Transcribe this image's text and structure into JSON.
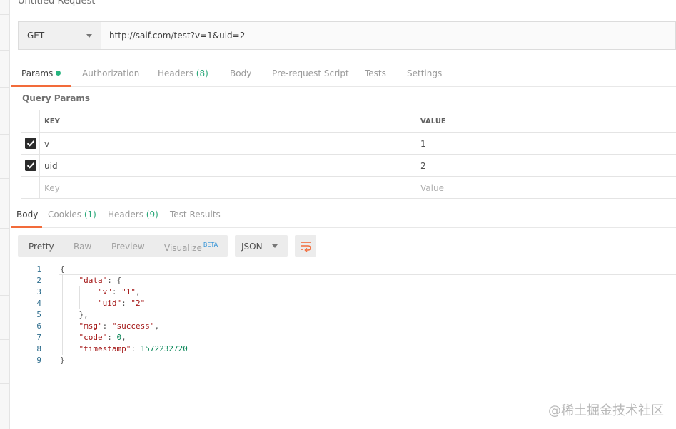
{
  "request": {
    "title": "Untitled Request",
    "method": "GET",
    "url": "http://saif.com/test?v=1&uid=2"
  },
  "request_tabs": [
    {
      "label": "Params",
      "active": true,
      "has_dot": true
    },
    {
      "label": "Authorization"
    },
    {
      "label": "Headers",
      "count": "(8)"
    },
    {
      "label": "Body"
    },
    {
      "label": "Pre-request Script"
    },
    {
      "label": "Tests"
    },
    {
      "label": "Settings"
    }
  ],
  "query_params": {
    "title": "Query Params",
    "header": {
      "key": "KEY",
      "value": "VALUE"
    },
    "rows": [
      {
        "key": "v",
        "value": "1",
        "checked": true
      },
      {
        "key": "uid",
        "value": "2",
        "checked": true
      }
    ],
    "placeholder": {
      "key": "Key",
      "value": "Value"
    }
  },
  "response_tabs": [
    {
      "label": "Body",
      "active": true
    },
    {
      "label": "Cookies",
      "count": "(1)"
    },
    {
      "label": "Headers",
      "count": "(9)"
    },
    {
      "label": "Test Results"
    }
  ],
  "view_modes": [
    "Pretty",
    "Raw",
    "Preview",
    "Visualize"
  ],
  "active_view": "Pretty",
  "beta_label": "BETA",
  "format": "JSON",
  "code_lines": [
    "1",
    "2",
    "3",
    "4",
    "5",
    "6",
    "7",
    "8",
    "9"
  ],
  "response_body": {
    "data_key": "\"data\"",
    "v_key": "\"v\"",
    "v_val": "\"1\"",
    "uid_key": "\"uid\"",
    "uid_val": "\"2\"",
    "msg_key": "\"msg\"",
    "msg_val": "\"success\"",
    "code_key": "\"code\"",
    "code_val": "0",
    "ts_key": "\"timestamp\"",
    "ts_val": "1572232720"
  },
  "watermark": "@稀土掘金技术社区",
  "colors": {
    "accent": "#f26b3a",
    "status_dot": "#26b47f",
    "count": "#2ba87a",
    "json_key": "#a31515",
    "json_number": "#098658",
    "line_number": "#2f6e8e"
  }
}
